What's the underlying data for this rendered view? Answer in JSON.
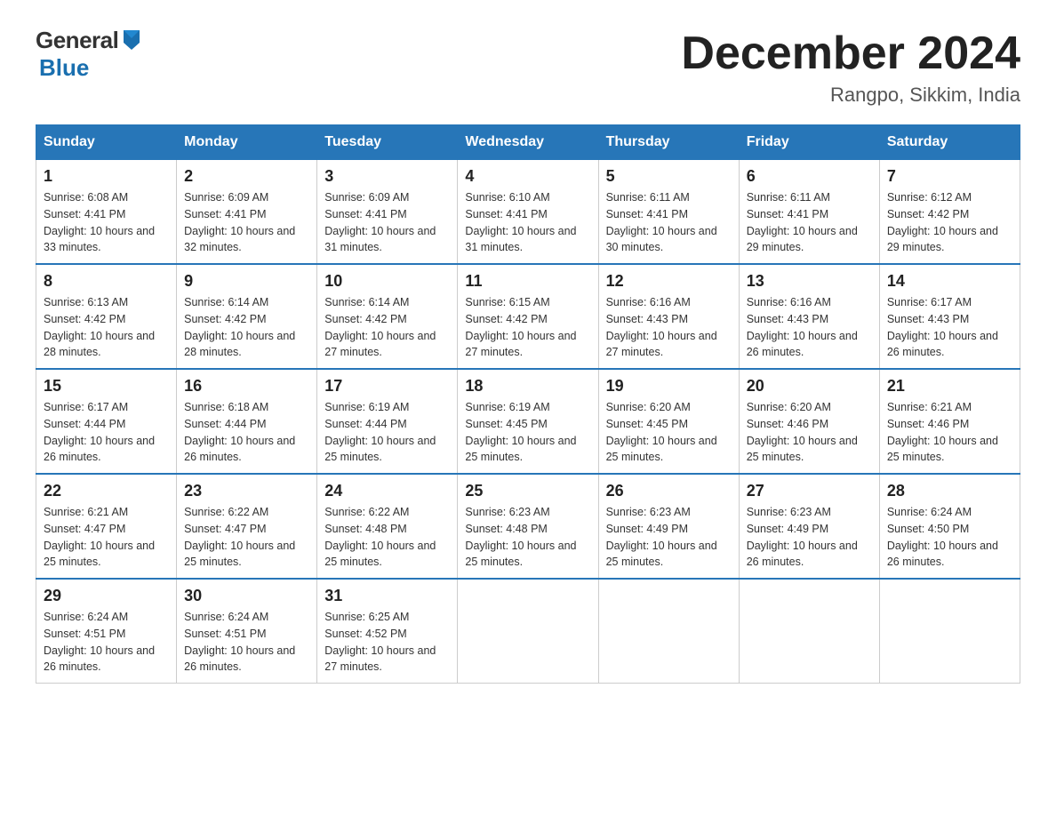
{
  "header": {
    "title": "December 2024",
    "subtitle": "Rangpo, Sikkim, India",
    "logo_general": "General",
    "logo_blue": "Blue"
  },
  "days_of_week": [
    "Sunday",
    "Monday",
    "Tuesday",
    "Wednesday",
    "Thursday",
    "Friday",
    "Saturday"
  ],
  "weeks": [
    [
      {
        "day": "1",
        "sunrise": "6:08 AM",
        "sunset": "4:41 PM",
        "daylight": "10 hours and 33 minutes."
      },
      {
        "day": "2",
        "sunrise": "6:09 AM",
        "sunset": "4:41 PM",
        "daylight": "10 hours and 32 minutes."
      },
      {
        "day": "3",
        "sunrise": "6:09 AM",
        "sunset": "4:41 PM",
        "daylight": "10 hours and 31 minutes."
      },
      {
        "day": "4",
        "sunrise": "6:10 AM",
        "sunset": "4:41 PM",
        "daylight": "10 hours and 31 minutes."
      },
      {
        "day": "5",
        "sunrise": "6:11 AM",
        "sunset": "4:41 PM",
        "daylight": "10 hours and 30 minutes."
      },
      {
        "day": "6",
        "sunrise": "6:11 AM",
        "sunset": "4:41 PM",
        "daylight": "10 hours and 29 minutes."
      },
      {
        "day": "7",
        "sunrise": "6:12 AM",
        "sunset": "4:42 PM",
        "daylight": "10 hours and 29 minutes."
      }
    ],
    [
      {
        "day": "8",
        "sunrise": "6:13 AM",
        "sunset": "4:42 PM",
        "daylight": "10 hours and 28 minutes."
      },
      {
        "day": "9",
        "sunrise": "6:14 AM",
        "sunset": "4:42 PM",
        "daylight": "10 hours and 28 minutes."
      },
      {
        "day": "10",
        "sunrise": "6:14 AM",
        "sunset": "4:42 PM",
        "daylight": "10 hours and 27 minutes."
      },
      {
        "day": "11",
        "sunrise": "6:15 AM",
        "sunset": "4:42 PM",
        "daylight": "10 hours and 27 minutes."
      },
      {
        "day": "12",
        "sunrise": "6:16 AM",
        "sunset": "4:43 PM",
        "daylight": "10 hours and 27 minutes."
      },
      {
        "day": "13",
        "sunrise": "6:16 AM",
        "sunset": "4:43 PM",
        "daylight": "10 hours and 26 minutes."
      },
      {
        "day": "14",
        "sunrise": "6:17 AM",
        "sunset": "4:43 PM",
        "daylight": "10 hours and 26 minutes."
      }
    ],
    [
      {
        "day": "15",
        "sunrise": "6:17 AM",
        "sunset": "4:44 PM",
        "daylight": "10 hours and 26 minutes."
      },
      {
        "day": "16",
        "sunrise": "6:18 AM",
        "sunset": "4:44 PM",
        "daylight": "10 hours and 26 minutes."
      },
      {
        "day": "17",
        "sunrise": "6:19 AM",
        "sunset": "4:44 PM",
        "daylight": "10 hours and 25 minutes."
      },
      {
        "day": "18",
        "sunrise": "6:19 AM",
        "sunset": "4:45 PM",
        "daylight": "10 hours and 25 minutes."
      },
      {
        "day": "19",
        "sunrise": "6:20 AM",
        "sunset": "4:45 PM",
        "daylight": "10 hours and 25 minutes."
      },
      {
        "day": "20",
        "sunrise": "6:20 AM",
        "sunset": "4:46 PM",
        "daylight": "10 hours and 25 minutes."
      },
      {
        "day": "21",
        "sunrise": "6:21 AM",
        "sunset": "4:46 PM",
        "daylight": "10 hours and 25 minutes."
      }
    ],
    [
      {
        "day": "22",
        "sunrise": "6:21 AM",
        "sunset": "4:47 PM",
        "daylight": "10 hours and 25 minutes."
      },
      {
        "day": "23",
        "sunrise": "6:22 AM",
        "sunset": "4:47 PM",
        "daylight": "10 hours and 25 minutes."
      },
      {
        "day": "24",
        "sunrise": "6:22 AM",
        "sunset": "4:48 PM",
        "daylight": "10 hours and 25 minutes."
      },
      {
        "day": "25",
        "sunrise": "6:23 AM",
        "sunset": "4:48 PM",
        "daylight": "10 hours and 25 minutes."
      },
      {
        "day": "26",
        "sunrise": "6:23 AM",
        "sunset": "4:49 PM",
        "daylight": "10 hours and 25 minutes."
      },
      {
        "day": "27",
        "sunrise": "6:23 AM",
        "sunset": "4:49 PM",
        "daylight": "10 hours and 26 minutes."
      },
      {
        "day": "28",
        "sunrise": "6:24 AM",
        "sunset": "4:50 PM",
        "daylight": "10 hours and 26 minutes."
      }
    ],
    [
      {
        "day": "29",
        "sunrise": "6:24 AM",
        "sunset": "4:51 PM",
        "daylight": "10 hours and 26 minutes."
      },
      {
        "day": "30",
        "sunrise": "6:24 AM",
        "sunset": "4:51 PM",
        "daylight": "10 hours and 26 minutes."
      },
      {
        "day": "31",
        "sunrise": "6:25 AM",
        "sunset": "4:52 PM",
        "daylight": "10 hours and 27 minutes."
      },
      null,
      null,
      null,
      null
    ]
  ]
}
